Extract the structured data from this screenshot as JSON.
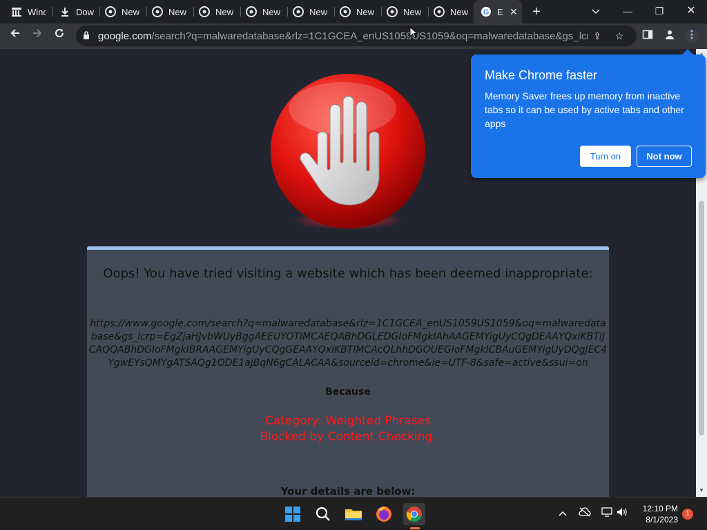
{
  "tabs": [
    {
      "label": "Wind",
      "icon": "archive-icon"
    },
    {
      "label": "Dowr",
      "icon": "download-icon"
    },
    {
      "label": "New",
      "icon": "chrome-icon"
    },
    {
      "label": "New",
      "icon": "chrome-icon"
    },
    {
      "label": "New",
      "icon": "chrome-icon"
    },
    {
      "label": "New",
      "icon": "chrome-icon"
    },
    {
      "label": "New",
      "icon": "chrome-icon"
    },
    {
      "label": "New",
      "icon": "chrome-icon"
    },
    {
      "label": "New",
      "icon": "chrome-icon"
    },
    {
      "label": "New",
      "icon": "chrome-icon"
    },
    {
      "label": "E",
      "icon": "google-icon",
      "active": true
    }
  ],
  "address": {
    "host": "google.com",
    "path": "/search?q=malwaredatabase&rlz=1C1GCEA_enUS1059US1059&oq=malwaredatabase&gs_lcrp=EgZ..."
  },
  "page": {
    "title": "Oops! You have tried visiting a website which has been deemed inappropriate:",
    "blocked_url": "https://www.google.com/search?q=malwaredatabase&rlz=1C1GCEA_enUS1059US1059&oq=malwaredatabase&gs_lcrp=EgZjaHJvbWUyBggAEEUYOTIMCAEQABhDGLEDGIoFMgkIAhAAGEMYigUyCQgDEAAYQxiKBTIJCAQQABhDGIoFMgkIBRAAGEMYigUyCQgGEAAYQxiKBTIMCAcQLhhDGOUEGIoFMgkICBAuGEMYigUyDQgJEC4YgwEYsQMYgATSAQg1ODE1ajBqN6gCALACAA&sourceid=chrome&ie=UTF-8&safe=active&ssui=on",
    "because": "Because",
    "category": "Category: Weighted Phrases",
    "reason": "Blocked by Content Checking.",
    "details": "Your details are below:"
  },
  "popup": {
    "title": "Make Chrome faster",
    "body": "Memory Saver frees up memory from inactive tabs so it can be used by active tabs and other apps",
    "turn_on": "Turn on",
    "not_now": "Not now"
  },
  "taskbar": {
    "time": "12:10 PM",
    "date": "8/1/2023",
    "notifications": "1"
  },
  "colors": {
    "popup_bg": "#1a73e8",
    "card_bg": "#434a57",
    "reason_red": "#ff1a1a"
  }
}
